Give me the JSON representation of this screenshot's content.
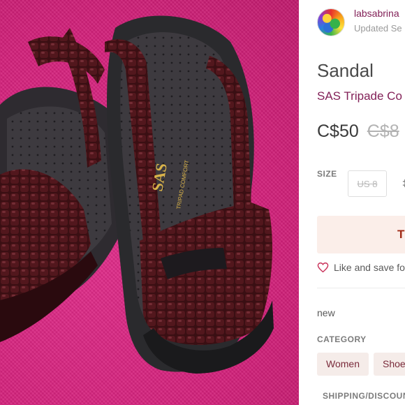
{
  "photo": {
    "alt": "sandal product photo",
    "insole_logo": "SAS",
    "insole_text": "TRIPAD COMFORT",
    "colors": {
      "background": "#d8217e",
      "leather": "#3a0f13",
      "insole": "#3d3a3f"
    }
  },
  "seller": {
    "username": "labsabrina",
    "updated": "Updated Se"
  },
  "listing": {
    "title": "Sandal",
    "brand": "SAS Tripade Co",
    "price": "C$50",
    "original_price": "C$8"
  },
  "size": {
    "label": "SIZE",
    "selected": "US 8",
    "extra": "‡"
  },
  "buy_button": {
    "label": "T"
  },
  "like": {
    "label": "Like and save fo",
    "icon": "heart-outline-icon"
  },
  "condition": "new",
  "category": {
    "label": "CATEGORY",
    "chips": [
      "Women",
      "Shoe"
    ]
  },
  "shipping": {
    "label": "SHIPPING/DISCOUN"
  },
  "colors": {
    "accent": "#822057",
    "buy_bg": "#fbeee9",
    "buy_text": "#a02a16",
    "chip_bg": "#f5ece9"
  }
}
